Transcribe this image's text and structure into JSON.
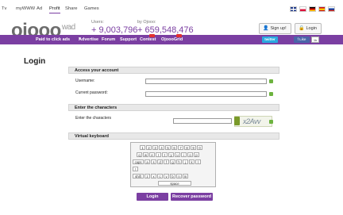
{
  "topnav": {
    "items": [
      "Tv",
      "myWWW",
      "Ad",
      "Profit",
      "Share",
      "Games"
    ],
    "active": "Profit"
  },
  "flags": [
    "gb-flag",
    "pl-flag",
    "de-flag",
    "es-flag",
    "ru-flag"
  ],
  "header": {
    "logo_text": "ojooo",
    "logo_suffix": "wad",
    "users_label": "Users:",
    "users_value": "+ 9,003,796",
    "by_label": "by Ojooo:",
    "by_value": "+ 659,548,476",
    "signup_label": "Sign up!",
    "login_label": "Login"
  },
  "menu": {
    "items": [
      "Paid to click ads",
      "Advertise",
      "Forum",
      "Support",
      "Contest",
      "OjoooGrid"
    ],
    "twitter_label": "twitter",
    "fb_like_label": "Like",
    "fb_count": "1k"
  },
  "page": {
    "title": "Login"
  },
  "form": {
    "section_account": "Access your account",
    "username_label": "Username:",
    "password_label": "Current password:",
    "section_chars": "Enter the characters",
    "chars_label": "Enter the characters",
    "captcha_text": "x2Avv",
    "section_keyboard": "Virtual keyboard",
    "login_button": "Login",
    "recover_button": "Recover password"
  },
  "keyboard": {
    "row1": [
      "1",
      "2",
      "3",
      "4",
      "5",
      "6",
      "7",
      "8",
      "9",
      "0"
    ],
    "row2": [
      "q",
      "w",
      "e",
      "r",
      "t",
      "y",
      "u",
      "i",
      "o",
      "p"
    ],
    "row3_label": "caps",
    "row3": [
      "a",
      "s",
      "d",
      "f",
      "g",
      "h",
      "j",
      "k",
      "l"
    ],
    "row4": [
      "!"
    ],
    "row5_label": "shift",
    "row5": [
      "z",
      "x",
      "c",
      "v",
      "b",
      "n",
      "m"
    ],
    "space_label": "space"
  },
  "colors": {
    "brand_purple": "#7b3fa2",
    "ok_green": "#6db33f",
    "twitter_blue": "#2aa9e0",
    "fb_blue": "#4a64a8"
  }
}
